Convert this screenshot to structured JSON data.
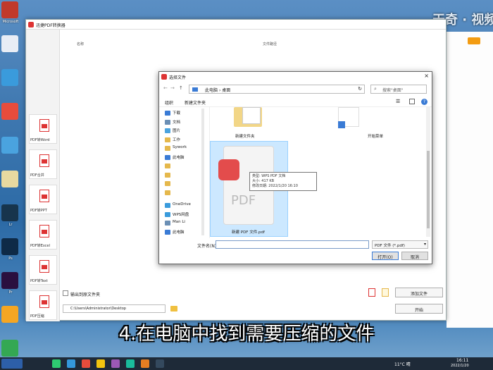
{
  "caption": "4.在电脑中找到需要压缩的文件",
  "watermark": "天奇 · 视频",
  "desktop": {
    "icons": [
      {
        "label": "Microsoft",
        "color": "#c0392b"
      },
      {
        "label": "",
        "color": "#e8edf5"
      },
      {
        "label": "",
        "color": "#3a9bdc"
      },
      {
        "label": "",
        "color": "#e74c3c"
      },
      {
        "label": "",
        "color": "#4aa3df"
      },
      {
        "label": "",
        "color": "#e8d9a0"
      },
      {
        "label": "Lr",
        "color": "#17344d"
      },
      {
        "label": "Ps",
        "color": "#0e2a47"
      },
      {
        "label": "Pr",
        "color": "#2a0f3f"
      },
      {
        "label": "",
        "color": "#f5a623"
      },
      {
        "label": "",
        "color": "#34a853"
      }
    ]
  },
  "app": {
    "title": "迅捷PDF转换器",
    "sidebar_tiles": [
      "PDF转Word",
      "PDF合并",
      "PDF转PPT",
      "PDF转Excel",
      "PDF转Text",
      "PDF压缩"
    ],
    "column_labels": [
      "名称",
      "文件路径"
    ],
    "checkbox_label": "输出到原文件夹",
    "output_path": "C:\\Users\\Administrator\\Desktop",
    "add_file_button": "添加文件",
    "start_button": "开始"
  },
  "dialog": {
    "title": "选择文件",
    "address": [
      "此电脑",
      "桌面"
    ],
    "search_placeholder": "搜索\"桌面\"",
    "toolbar": {
      "organize": "组织",
      "new_folder": "新建文件夹"
    },
    "nav_items": [
      {
        "label": "下载",
        "color": "#3a7bd5"
      },
      {
        "label": "文档",
        "color": "#6b8fb5"
      },
      {
        "label": "图片",
        "color": "#4aa3df"
      },
      {
        "label": "工作",
        "color": "#e5b84c"
      },
      {
        "label": "Sywork",
        "color": "#e5b84c"
      },
      {
        "label": "此电脑",
        "color": "#3a7bd5"
      },
      {
        "label": "",
        "color": "#e5b84c"
      },
      {
        "label": "",
        "color": "#e5b84c"
      },
      {
        "label": "",
        "color": "#e5b84c"
      },
      {
        "label": "",
        "color": "#e5b84c"
      },
      {
        "label": "OneDrive",
        "color": "#3a9bdc"
      },
      {
        "label": "WPS网盘",
        "color": "#3a9bdc"
      },
      {
        "label": "Man Li",
        "color": "#6b8fb5"
      },
      {
        "label": "此电脑",
        "color": "#3a7bd5"
      }
    ],
    "files": [
      {
        "name": "新建文件夹",
        "type": "folder"
      },
      {
        "name": "开始菜单",
        "type": "shortcut"
      },
      {
        "name": "新建 PDF 文件.pdf",
        "type": "pdf"
      }
    ],
    "tooltip": {
      "type": "类型: WPS PDF 文档",
      "size": "大小: 417 KB",
      "modified": "修改日期: 2022/1/20 16:10"
    },
    "filename_label": "文件名(N):",
    "filename_value": "",
    "filetype_value": "PDF 文件 (*.pdf)",
    "open_button": "打开(O)",
    "cancel_button": "取消"
  },
  "taskbar": {
    "start_label": "",
    "weather": "11°C 晴",
    "time": "16:11",
    "date": "2022/1/20",
    "icons": [
      {
        "color": "#2ecc71"
      },
      {
        "color": "#3498db"
      },
      {
        "color": "#e74c3c"
      },
      {
        "color": "#f1c40f"
      },
      {
        "color": "#9b59b6"
      },
      {
        "color": "#1abc9c"
      },
      {
        "color": "#e67e22"
      },
      {
        "color": "#34495e"
      }
    ]
  }
}
